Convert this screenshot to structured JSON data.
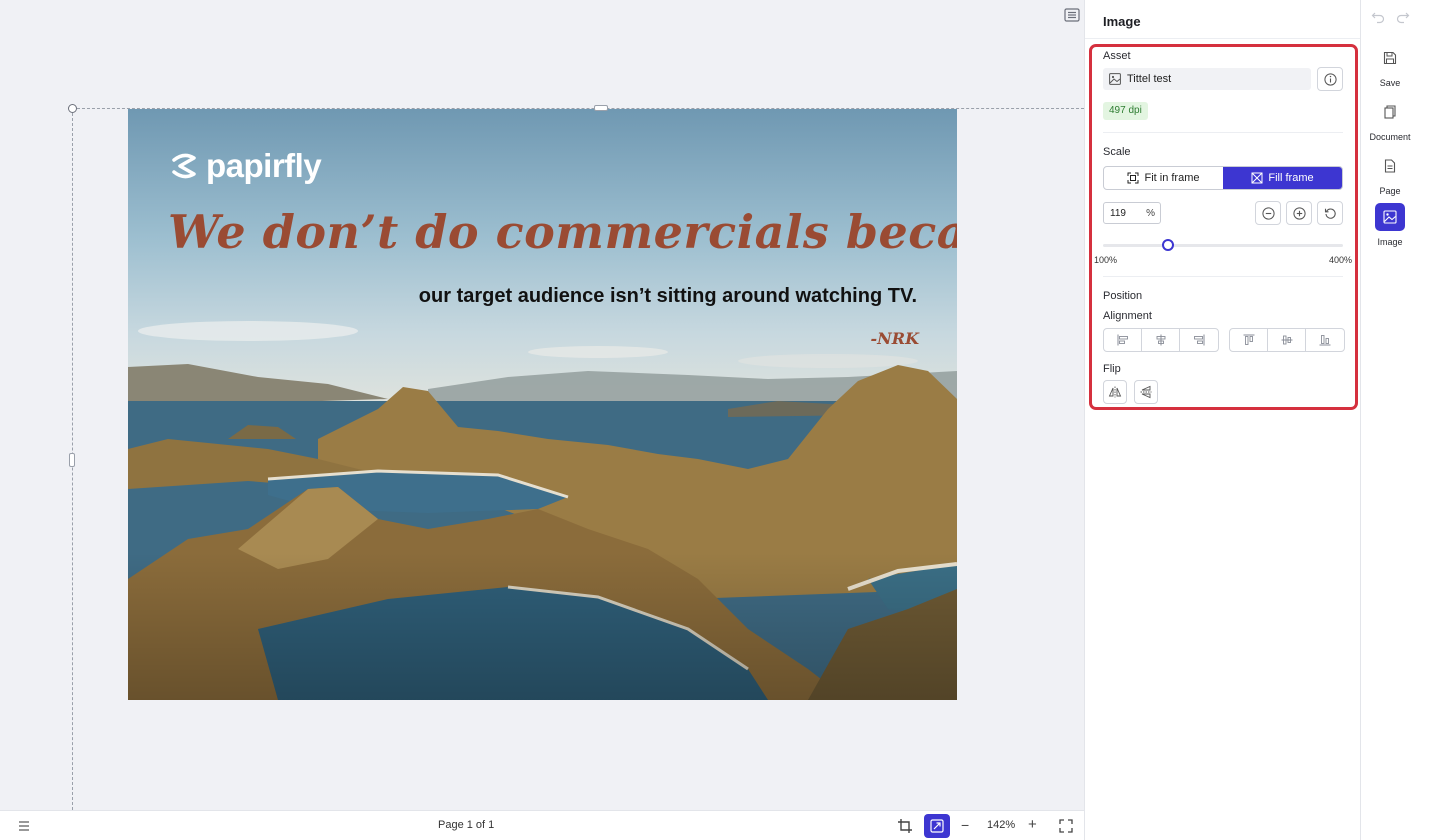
{
  "canvas": {
    "page_label": "Page 1 of 1",
    "zoom": "142%",
    "artwork": {
      "logo_text": "papirfly",
      "headline": "We don’t do commercials because…",
      "subline": "our target audience isn’t sitting around watching TV.",
      "signature": "-NRK"
    }
  },
  "panel": {
    "title": "Image",
    "asset": {
      "label": "Asset",
      "name": "Tittel test",
      "dpi": "497 dpi"
    },
    "scale": {
      "label": "Scale",
      "options": [
        "Fit in frame",
        "Fill frame"
      ],
      "selected": "Fill frame",
      "percent_value": "119",
      "percent_unit": "%",
      "slider_min_label": "100%",
      "slider_max_label": "400%",
      "slider_value": 119,
      "slider_range": [
        100,
        400
      ]
    },
    "position": {
      "label": "Position",
      "alignment_label": "Alignment",
      "flip_label": "Flip"
    }
  },
  "rail": {
    "items": [
      {
        "label": "Save",
        "icon": "save-icon"
      },
      {
        "label": "Document",
        "icon": "document-icon"
      },
      {
        "label": "Page",
        "icon": "page-icon"
      },
      {
        "label": "Image",
        "icon": "image-icon",
        "active": true
      }
    ]
  },
  "colors": {
    "accent": "#3d36d1",
    "highlight": "#d5303e",
    "headline": "#9a4b33",
    "dpi_ok_bg": "#e3f5e1",
    "dpi_ok_text": "#2e7d32"
  }
}
